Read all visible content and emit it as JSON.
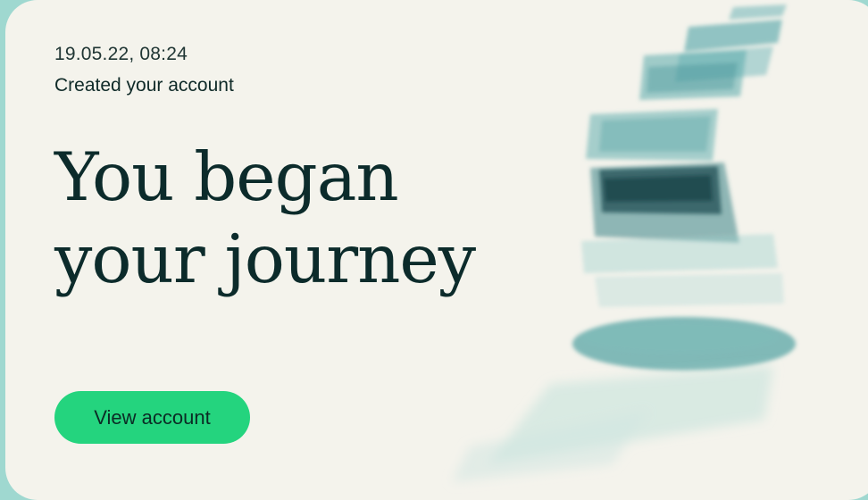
{
  "card": {
    "timestamp": "19.05.22, 08:24",
    "event_label": "Created your account",
    "headline_line1": "You began",
    "headline_line2": "your journey",
    "button_label": "View account"
  },
  "colors": {
    "page_background": "#9fd8d0",
    "card_background": "#f4f3ec",
    "headline": "#0c2b2b",
    "button": "#24d47e",
    "watercolor_teal": "#4fa3a6",
    "watercolor_dark": "#1f4f55"
  },
  "illustration": {
    "name": "watercolor-steps-illustration"
  }
}
